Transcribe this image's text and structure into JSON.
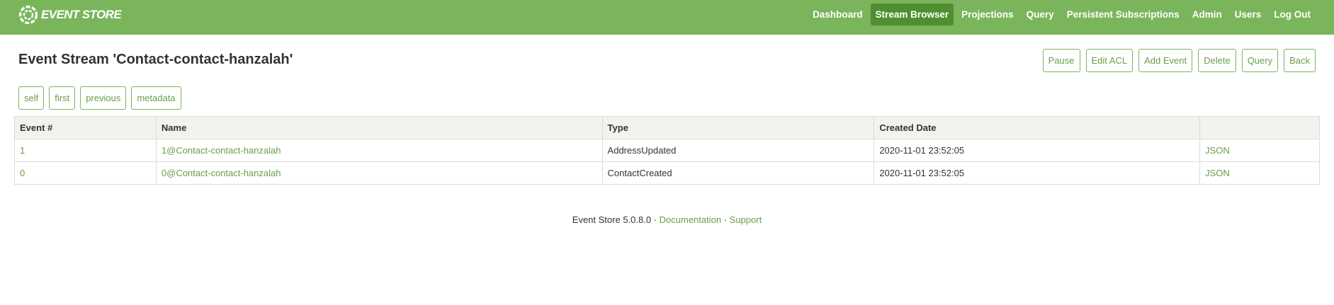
{
  "brand": {
    "name": "EVENT STORE",
    "icon": "event-store-logo-icon",
    "nav_color": "#7ab55c",
    "active_color": "#4f8f2f",
    "link_color": "#6a9e47"
  },
  "nav": {
    "items": [
      {
        "label": "Dashboard",
        "active": false
      },
      {
        "label": "Stream Browser",
        "active": true
      },
      {
        "label": "Projections",
        "active": false
      },
      {
        "label": "Query",
        "active": false
      },
      {
        "label": "Persistent Subscriptions",
        "active": false
      },
      {
        "label": "Admin",
        "active": false
      },
      {
        "label": "Users",
        "active": false
      },
      {
        "label": "Log Out",
        "active": false
      }
    ]
  },
  "page": {
    "title": "Event Stream 'Contact-contact-hanzalah'"
  },
  "actions": {
    "pause": "Pause",
    "edit_acl": "Edit ACL",
    "add_event": "Add Event",
    "delete": "Delete",
    "query": "Query",
    "back": "Back"
  },
  "links": {
    "self": "self",
    "first": "first",
    "previous": "previous",
    "metadata": "metadata"
  },
  "table": {
    "headers": {
      "event_num": "Event #",
      "name": "Name",
      "type": "Type",
      "created": "Created Date",
      "json": ""
    },
    "rows": [
      {
        "event_num": "1",
        "name": "1@Contact-contact-hanzalah",
        "type": "AddressUpdated",
        "created": "2020-11-01 23:52:05",
        "json": "JSON"
      },
      {
        "event_num": "0",
        "name": "0@Contact-contact-hanzalah",
        "type": "ContactCreated",
        "created": "2020-11-01 23:52:05",
        "json": "JSON"
      }
    ]
  },
  "footer": {
    "version": "Event Store 5.0.8.0",
    "sep1": " · ",
    "documentation": "Documentation",
    "sep2": " · ",
    "support": "Support"
  }
}
